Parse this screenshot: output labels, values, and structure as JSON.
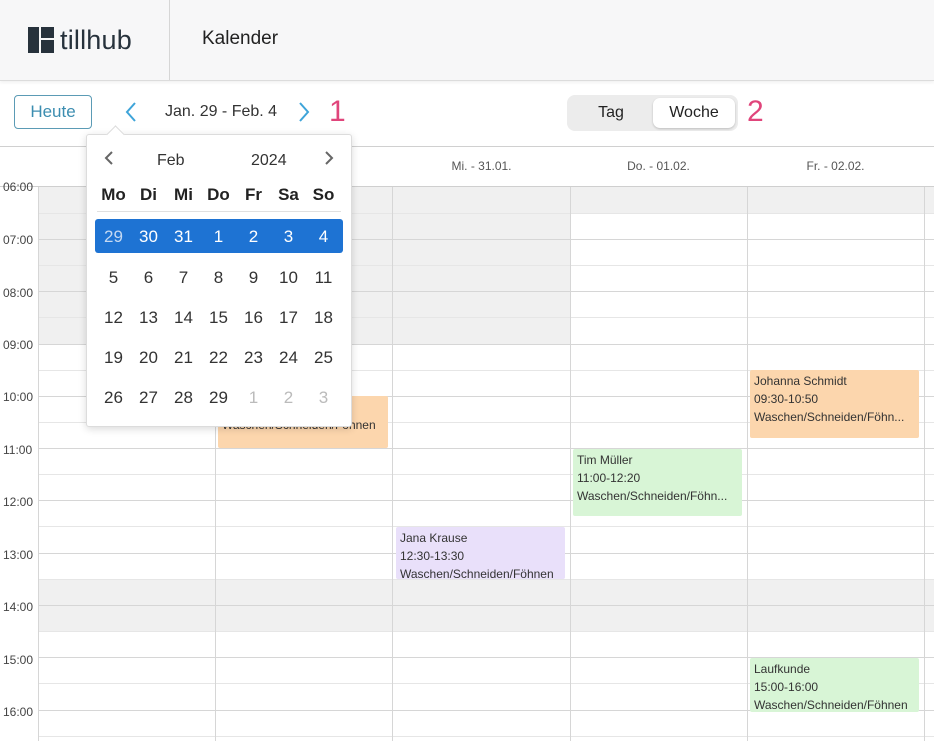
{
  "header": {
    "logo_text": "tillhub",
    "title": "Kalender"
  },
  "toolbar": {
    "today_label": "Heute",
    "prev_icon": "chevron-left",
    "next_icon": "chevron-right",
    "date_range": "Jan. 29 - Feb. 4",
    "marker_1": "1",
    "marker_2": "2",
    "views": {
      "day": "Tag",
      "week": "Woche",
      "active": "Woche"
    }
  },
  "calendar": {
    "days": [
      "Mi. - 31.01.",
      "Do. - 01.02.",
      "Fr. - 02.02."
    ],
    "partial_time_label": "06:00",
    "times": [
      "07:00",
      "08:00",
      "09:00",
      "10:00",
      "11:00",
      "12:00",
      "13:00",
      "14:00",
      "15:00",
      "16:00"
    ],
    "events": [
      {
        "name": "",
        "time": "10:00-11:00",
        "service": "Waschen/Schneiden/Föhnen",
        "color": "#fcd6ad"
      },
      {
        "name": "Jana Krause",
        "time": "12:30-13:30",
        "service": "Waschen/Schneiden/Föhnen",
        "color": "#e9e0fa"
      },
      {
        "name": "Tim Müller",
        "time": "11:00-12:20",
        "service": "Waschen/Schneiden/Föhn...",
        "color": "#d8f5d6"
      },
      {
        "name": "Johanna Schmidt",
        "time": "09:30-10:50",
        "service": "Waschen/Schneiden/Föhn...",
        "color": "#fcd6ad"
      },
      {
        "name": "Laufkunde",
        "time": "15:00-16:00",
        "service": "Waschen/Schneiden/Föhnen",
        "color": "#d8f5d6"
      }
    ]
  },
  "datepicker": {
    "month": "Feb",
    "year": "2024",
    "weekdays": [
      "Mo",
      "Di",
      "Mi",
      "Do",
      "Fr",
      "Sa",
      "So"
    ],
    "weeks": [
      [
        "29",
        "30",
        "31",
        "1",
        "2",
        "3",
        "4"
      ],
      [
        "5",
        "6",
        "7",
        "8",
        "9",
        "10",
        "11"
      ],
      [
        "12",
        "13",
        "14",
        "15",
        "16",
        "17",
        "18"
      ],
      [
        "19",
        "20",
        "21",
        "22",
        "23",
        "24",
        "25"
      ],
      [
        "26",
        "27",
        "28",
        "29",
        "1",
        "2",
        "3"
      ]
    ],
    "selected_week_index": 0,
    "selection_color": "#1e73d3"
  }
}
